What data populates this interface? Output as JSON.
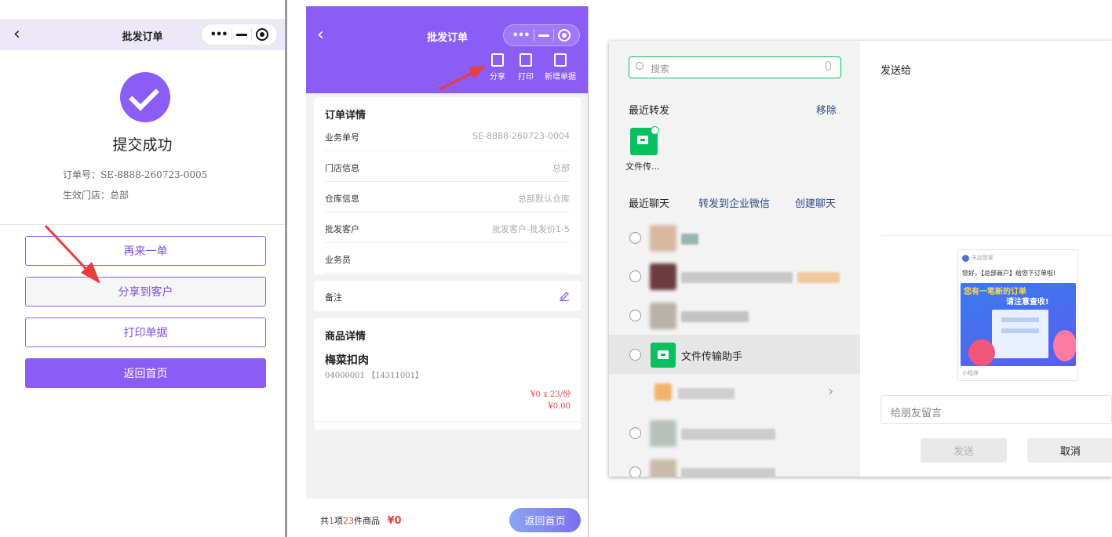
{
  "colors": {
    "accent": "#8b5cf6",
    "wechat_green": "#07c160",
    "price_red": "#e64340",
    "arrow_red": "#ee3b3b"
  },
  "panel1": {
    "nav": {
      "back_icon": "chevron-left-icon",
      "title": "批发订单"
    },
    "success_text": "提交成功",
    "order_no": "订单号：SE-8888-260723-0005",
    "store": "生效门店：总部",
    "buttons": {
      "again": "再来一单",
      "share": "分享到客户",
      "print": "打印单据",
      "home": "返回首页"
    }
  },
  "panel2": {
    "nav": {
      "title": "批发订单"
    },
    "tools": [
      {
        "label": "分享",
        "icon": "share-icon"
      },
      {
        "label": "打印",
        "icon": "print-icon"
      },
      {
        "label": "新增单据",
        "icon": "new-doc-icon"
      }
    ],
    "order": {
      "title": "订单详情",
      "rows": [
        {
          "key": "业务单号",
          "value": "SE-8888-260723-0004"
        },
        {
          "key": "门店信息",
          "value": "总部"
        },
        {
          "key": "仓库信息",
          "value": "总部默认仓库"
        },
        {
          "key": "批发客户",
          "value": "批发客户-批发价1-5"
        },
        {
          "key": "业务员",
          "value": ""
        }
      ]
    },
    "remark": {
      "label": "备注"
    },
    "goods": {
      "title": "商品详情",
      "name": "梅菜扣肉",
      "code": "04000001 【14311001】",
      "unit_price": "¥0 x 23/份",
      "subtotal": "¥0.00"
    },
    "footer": {
      "pre": "共",
      "items": "1",
      "mid": "项",
      "qty": "23",
      "post": "件商品",
      "total": "¥0",
      "home": "返回首页"
    }
  },
  "panel3": {
    "search_placeholder": "搜索",
    "recent_forward": "最近转发",
    "remove": "移除",
    "file_assistant_short": "文件传...",
    "recent_chats": "最近聊天",
    "forward_enterprise": "转发到企业微信",
    "create_chat": "创建聊天",
    "file_assistant": "文件传输助手",
    "send_to": "发送给",
    "card": {
      "app_name": "天店管家",
      "greeting": "您好，【总部商户】给您下订单啦!",
      "banner_line1": "您有一笔新的订单",
      "banner_line2": "请注意查收!",
      "footer": "小程序"
    },
    "message_placeholder": "给朋友留言",
    "send": "发送",
    "cancel": "取消"
  }
}
